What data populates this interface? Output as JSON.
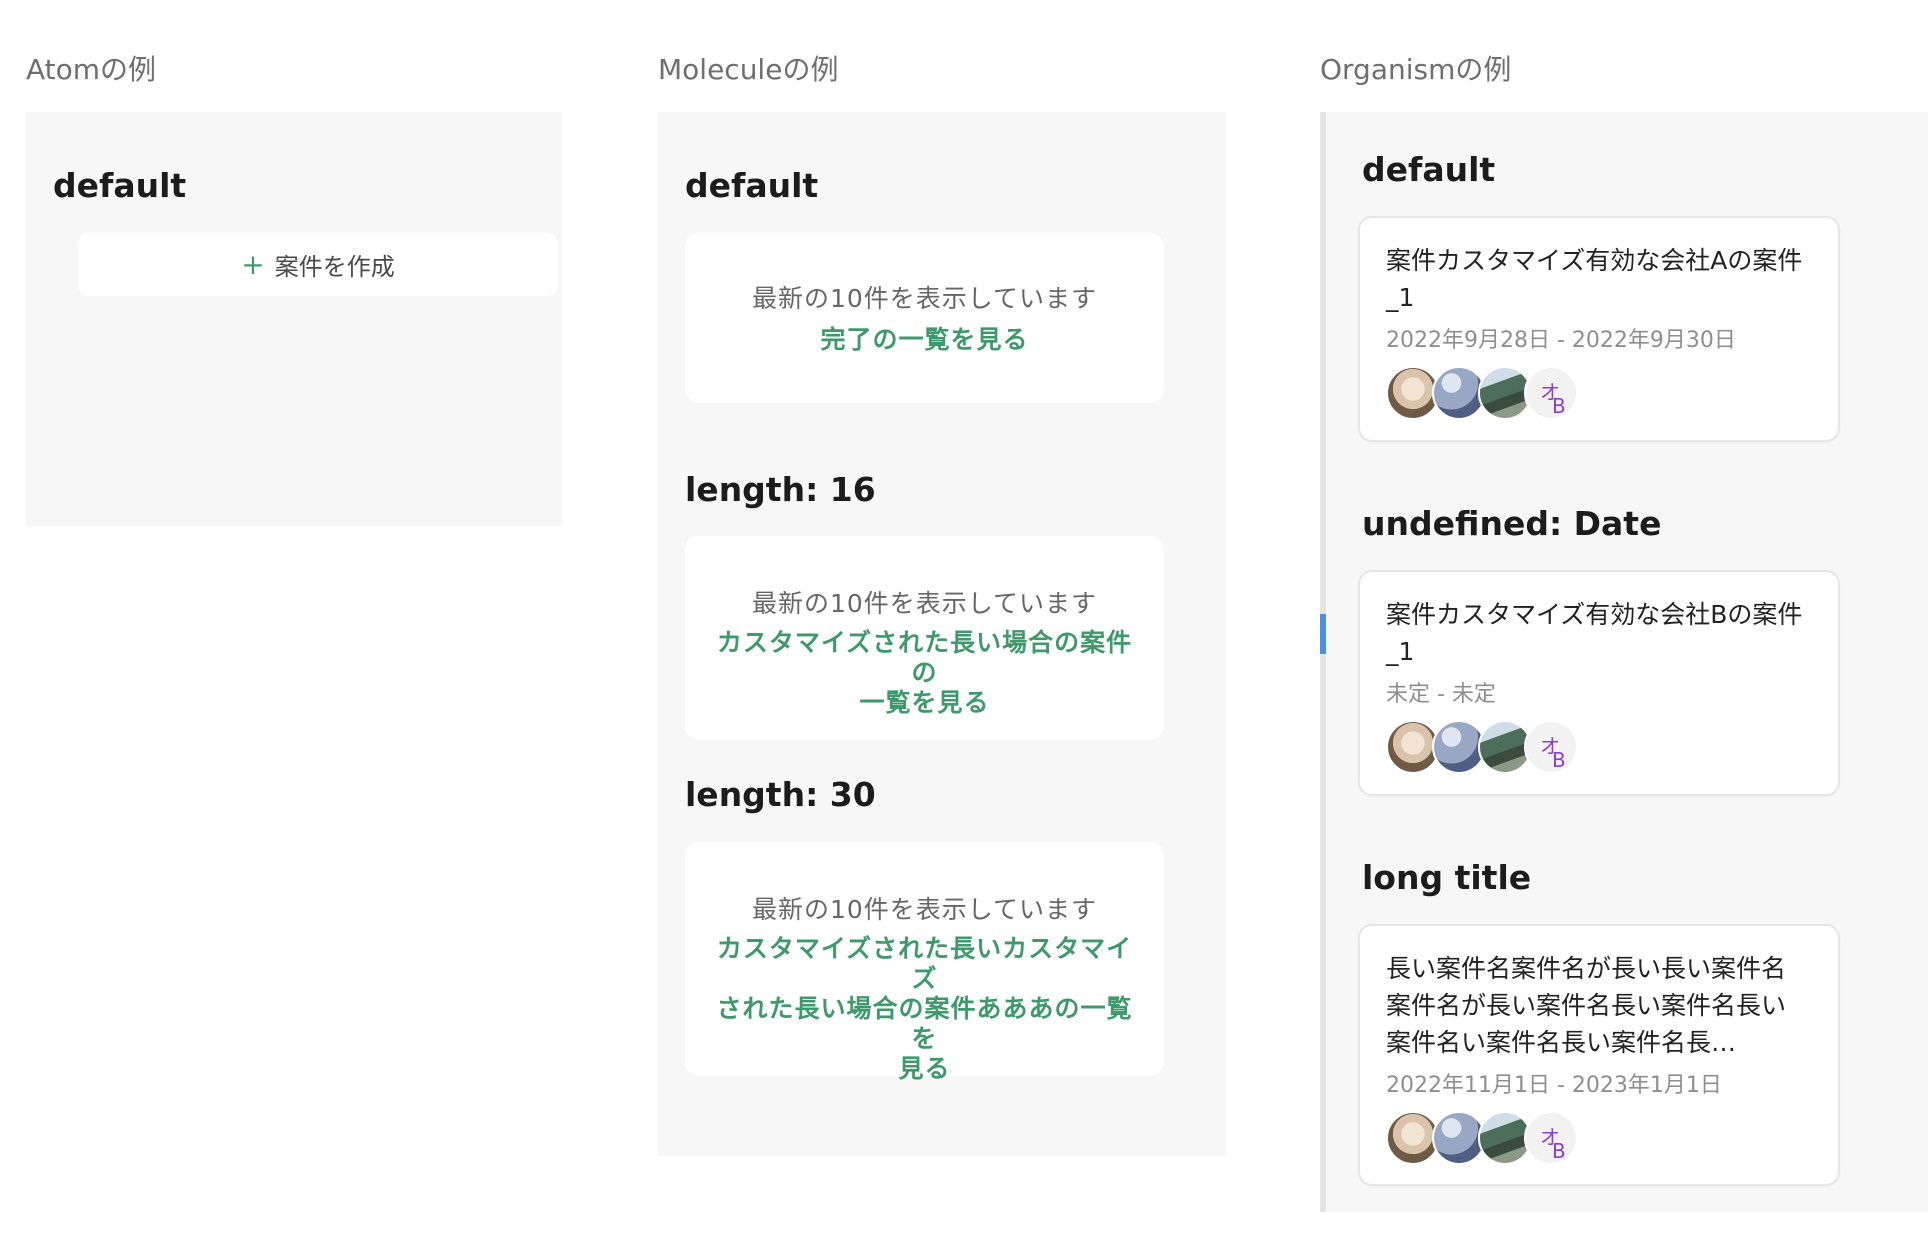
{
  "atom": {
    "heading": "Atomの例",
    "section_title": "default",
    "create_button_label": "案件を作成",
    "create_button_icon": "plus-icon"
  },
  "molecule": {
    "heading": "Moleculeの例",
    "sections": [
      {
        "title": "default",
        "info": "最新の10件を表示しています",
        "link_lines": [
          "完了の一覧を見る"
        ]
      },
      {
        "title": "length: 16",
        "info": "最新の10件を表示しています",
        "link_lines": [
          "カスタマイズされた長い場合の案件の",
          "一覧を見る"
        ]
      },
      {
        "title": "length: 30",
        "info": "最新の10件を表示しています",
        "link_lines": [
          "カスタマイズされた長いカスタマイズ",
          "された長い場合の案件あああの一覧を",
          "見る"
        ]
      }
    ]
  },
  "organism": {
    "heading": "Organismの例",
    "sections": [
      {
        "title": "default",
        "card": {
          "title_lines": [
            "案件カスタマイズ有効な会社Aの案件",
            "_1"
          ],
          "date": "2022年9月28日 - 2022年9月30日"
        }
      },
      {
        "title": "undefined: Date",
        "card": {
          "title_lines": [
            "案件カスタマイズ有効な会社Bの案件",
            "_1"
          ],
          "date": "未定 - 未定"
        }
      },
      {
        "title": "long title",
        "card": {
          "title_lines": [
            "長い案件名案件名が長い長い案件名",
            "案件名が長い案件名長い案件名長い",
            "案件名い案件名長い案件名長…"
          ],
          "date": "2022年11月1日 - 2023年1月1日"
        }
      }
    ],
    "avatar_initials": [
      "オ",
      "B"
    ]
  },
  "colors": {
    "accent_green": "#3f9a6b",
    "initials_purple": "#8a3fd0",
    "scroll_indicator": "#4a90e2",
    "panel_bg": "#f7f7f7"
  }
}
